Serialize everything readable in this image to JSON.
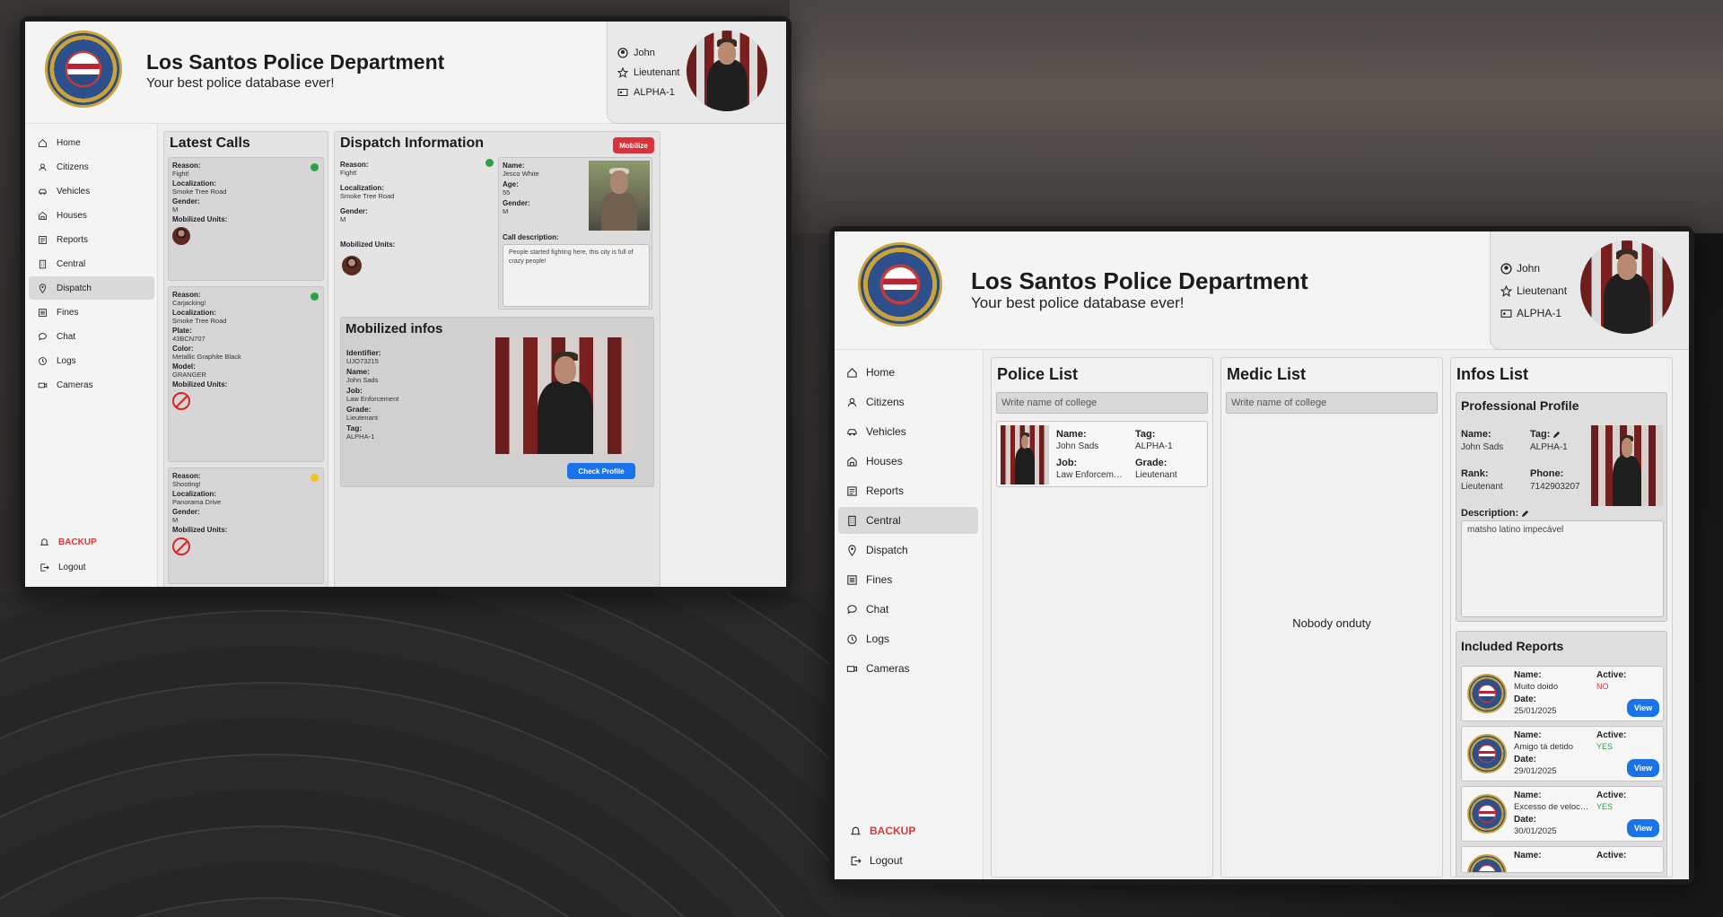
{
  "header": {
    "title": "Los Santos Police Department",
    "subtitle": "Your best police database ever!",
    "user": {
      "name": "John",
      "rank": "Lieutenant",
      "callsign": "ALPHA-1"
    }
  },
  "sidebar": {
    "items": [
      {
        "label": "Home",
        "icon": "home-icon"
      },
      {
        "label": "Citizens",
        "icon": "user-icon"
      },
      {
        "label": "Vehicles",
        "icon": "car-icon"
      },
      {
        "label": "Houses",
        "icon": "house-icon"
      },
      {
        "label": "Reports",
        "icon": "reports-icon"
      },
      {
        "label": "Central",
        "icon": "building-icon"
      },
      {
        "label": "Dispatch",
        "icon": "pin-icon"
      },
      {
        "label": "Fines",
        "icon": "list-icon"
      },
      {
        "label": "Chat",
        "icon": "chat-icon"
      },
      {
        "label": "Logs",
        "icon": "clock-icon"
      },
      {
        "label": "Cameras",
        "icon": "camera-icon"
      }
    ],
    "backup": "BACKUP",
    "logout": "Logout"
  },
  "left": {
    "active_nav": "Dispatch",
    "latest_calls": {
      "title": "Latest Calls",
      "calls": [
        {
          "status_color": "#2ea043",
          "fields": [
            [
              "Reason:",
              "Fight!"
            ],
            [
              "Localization:",
              "Smoke Tree Road"
            ],
            [
              "Gender:",
              "M"
            ]
          ],
          "units_label": "Mobilized Units:",
          "units": "avatar"
        },
        {
          "status_color": "#2ea043",
          "fields": [
            [
              "Reason:",
              "Carjacking!"
            ],
            [
              "Localization:",
              "Smoke Tree Road"
            ],
            [
              "Plate:",
              "43BCN707"
            ],
            [
              "Color:",
              "Metallic Graphite Black"
            ],
            [
              "Model:",
              "GRANGER"
            ]
          ],
          "units_label": "Mobilized Units:",
          "units": "none"
        },
        {
          "status_color": "#f0c420",
          "fields": [
            [
              "Reason:",
              "Shooting!"
            ],
            [
              "Localization:",
              "Panorama Drive"
            ],
            [
              "Gender:",
              "M"
            ]
          ],
          "units_label": "Mobilized Units:",
          "units": "none"
        }
      ]
    },
    "dispatch": {
      "title": "Dispatch Information",
      "mobilize": "Mobilize",
      "status_color": "#2ea043",
      "fields": [
        [
          "Reason:",
          "Fight!"
        ],
        [
          "Localization:",
          "Smoke Tree Road"
        ],
        [
          "Gender:",
          "M"
        ]
      ],
      "units_label": "Mobilized Units:",
      "caller": [
        [
          "Name:",
          "Jesco White"
        ],
        [
          "Age:",
          "55"
        ],
        [
          "Gender:",
          "M"
        ]
      ],
      "call_description_label": "Call description:",
      "call_description": "People started fighting here, this city is full of crazy people!"
    },
    "mobilized": {
      "title": "Mobilized infos",
      "fields": [
        [
          "Identifier:",
          "UJO73215"
        ],
        [
          "Name:",
          "John Sads"
        ],
        [
          "Job:",
          "Law Enforcement"
        ],
        [
          "Grade:",
          "Lieutenant"
        ],
        [
          "Tag:",
          "ALPHA-1"
        ]
      ],
      "check_profile": "Check Profile"
    }
  },
  "right": {
    "active_nav": "Central",
    "police_list": {
      "title": "Police List",
      "placeholder": "Write name of college",
      "officers": [
        {
          "name_label": "Name:",
          "name": "John Sads",
          "tag_label": "Tag:",
          "tag": "ALPHA-1",
          "job_label": "Job:",
          "job": "Law Enforcem…",
          "grade_label": "Grade:",
          "grade": "Lieutenant"
        }
      ]
    },
    "medic_list": {
      "title": "Medic List",
      "placeholder": "Write name of college",
      "empty": "Nobody onduty"
    },
    "infos_list": {
      "title": "Infos List",
      "profile": {
        "title": "Professional Profile",
        "name_label": "Name:",
        "name": "John Sads",
        "tag_label": "Tag:",
        "tag": "ALPHA-1",
        "rank_label": "Rank:",
        "rank": "Lieutenant",
        "phone_label": "Phone:",
        "phone": "7142903207",
        "description_label": "Description:",
        "description": "matsho latino impecável"
      },
      "reports": {
        "title": "Included Reports",
        "name_label": "Name:",
        "active_label": "Active:",
        "date_label": "Date:",
        "view": "View",
        "items": [
          {
            "name": "Muito doido",
            "active": "NO",
            "active_color": "#d9323c",
            "date": "25/01/2025"
          },
          {
            "name": "Amigo tá detido",
            "active": "YES",
            "active_color": "#2ea043",
            "date": "29/01/2025"
          },
          {
            "name": "Excesso de veloc…",
            "active": "YES",
            "active_color": "#2ea043",
            "date": "30/01/2025"
          }
        ],
        "partial_name_label": "Name:",
        "partial_active_label": "Active:"
      }
    }
  }
}
